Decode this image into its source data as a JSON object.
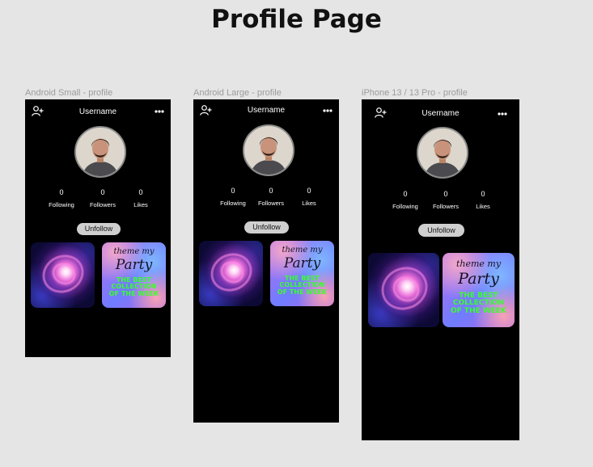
{
  "page_title": "Profile Page",
  "frames": [
    {
      "label": "Android Small - profile",
      "username": "Username",
      "stats": [
        {
          "value": "0",
          "label": "Following"
        },
        {
          "value": "0",
          "label": "Followers"
        },
        {
          "value": "0",
          "label": "Likes"
        }
      ],
      "button_label": "Unfollow",
      "post_text": {
        "script_line1": "theme my",
        "script_line2": "Party",
        "headline": [
          "THE BEST",
          "COLLECTION",
          "OF THE WEEK"
        ]
      }
    },
    {
      "label": "Android Large - profile",
      "username": "Username",
      "stats": [
        {
          "value": "0",
          "label": "Following"
        },
        {
          "value": "0",
          "label": "Followers"
        },
        {
          "value": "0",
          "label": "Likes"
        }
      ],
      "button_label": "Unfollow",
      "post_text": {
        "script_line1": "theme my",
        "script_line2": "Party",
        "headline": [
          "THE BEST",
          "COLLECTION",
          "OF THE WEEK"
        ]
      }
    },
    {
      "label": "iPhone 13 / 13 Pro - profile",
      "username": "Username",
      "stats": [
        {
          "value": "0",
          "label": "Following"
        },
        {
          "value": "0",
          "label": "Followers"
        },
        {
          "value": "0",
          "label": "Likes"
        }
      ],
      "button_label": "Unfollow",
      "post_text": {
        "script_line1": "theme my",
        "script_line2": "Party",
        "headline": [
          "THE BEST",
          "COLLECTION",
          "OF THE WEEK"
        ]
      }
    }
  ],
  "icons": {
    "add_user": "add-user-icon",
    "more": "more-dots-icon"
  },
  "colors": {
    "background": "#e5e5e5",
    "frame": "#000000",
    "button": "#cfcfcf",
    "headline_green": "#39ff2e"
  }
}
